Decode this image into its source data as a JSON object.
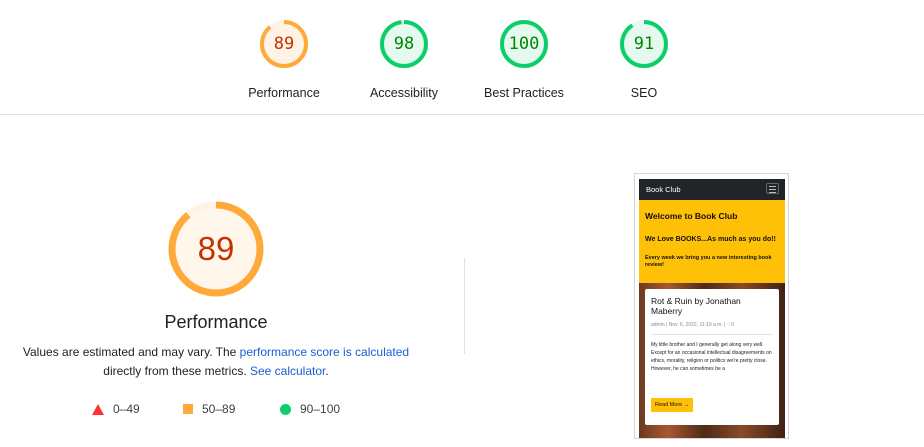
{
  "categories": [
    {
      "score": "89",
      "label": "Performance",
      "score_fraction": 0.89,
      "color": "#ffa93b"
    },
    {
      "score": "98",
      "label": "Accessibility",
      "score_fraction": 0.98,
      "color": "#0cce6b"
    },
    {
      "score": "100",
      "label": "Best Practices",
      "score_fraction": 1.0,
      "color": "#0cce6b"
    },
    {
      "score": "91",
      "label": "SEO",
      "score_fraction": 0.91,
      "color": "#0cce6b"
    }
  ],
  "performance": {
    "score": "89",
    "score_fraction": 0.89,
    "title": "Performance",
    "desc_prefix": "Values are estimated and may vary. The ",
    "desc_link1": "performance score is calculated",
    "desc_middle": "directly from these metrics. ",
    "desc_link2": "See calculator",
    "desc_suffix": "."
  },
  "legend": [
    {
      "range": "0–49",
      "color": "#ff3333",
      "shape": "triangle"
    },
    {
      "range": "50–89",
      "color": "#ffa93b",
      "shape": "square"
    },
    {
      "range": "90–100",
      "color": "#0cce6b",
      "shape": "circle"
    }
  ],
  "screenshot": {
    "brand": "Book Club",
    "hero_title": "Welcome to Book Club",
    "hero_sub": "We Love BOOKS...As much as you do!!",
    "hero_small": "Every week we bring you a new interesting book review!",
    "card_title": "Rot & Ruin by Jonathan Maberry",
    "card_meta": "admin | Nov. 6, 2022, 11:19 a.m. | ♡0",
    "card_body": "My little brother and I generally get along very well. Except for an occasional intellectual disagreements on ethics, morality, religion or politics we're pretty close. However, he can sometimes be a",
    "card_button": "Read More →"
  }
}
